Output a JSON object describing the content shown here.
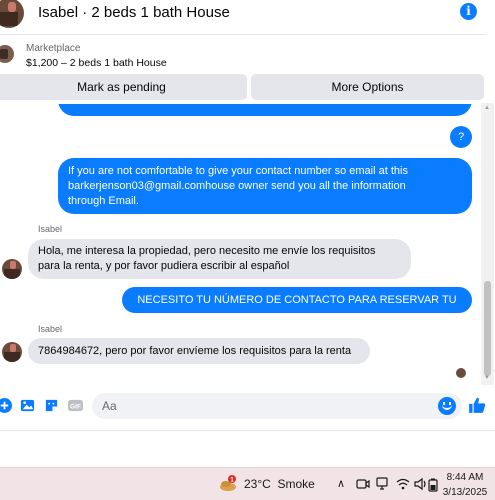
{
  "header": {
    "title": "Isabel · 2 beds 1 bath House",
    "info_icon": "info-icon",
    "info_glyph": "i"
  },
  "listing": {
    "source": "Marketplace",
    "price_title": "$1,200 – 2 beds 1 bath House"
  },
  "actions": {
    "mark_pending": "Mark as pending",
    "more_options": "More Options"
  },
  "messages": [
    {
      "from": "me",
      "text": "?"
    },
    {
      "from": "me",
      "lines": [
        "If you are not comfortable to give your contact number so email at this",
        "barkerjenson03@gmail.comhouse owner send you all the information",
        "through Email."
      ]
    },
    {
      "from": "Isabel",
      "sender_label": "Isabel",
      "lines": [
        "Hola, me interesa la propiedad, pero necesito me envíe los requisitos",
        "para la renta, y por favor pudiera escribir al español"
      ]
    },
    {
      "from": "me",
      "text": "NECESITO TU NÚMERO DE CONTACTO PARA RESERVAR TU TOUR"
    },
    {
      "from": "Isabel",
      "sender_label": "Isabel",
      "text": "7864984672, pero por favor envíeme los requisitos para la renta"
    }
  ],
  "composer": {
    "placeholder": "Aa",
    "gif_label": "GIF",
    "icons": [
      "plus-circle-icon",
      "image-icon",
      "sticker-icon",
      "gif-icon",
      "emoji-icon",
      "thumbs-up-icon"
    ]
  },
  "taskbar": {
    "temperature": "23°C",
    "weather": "Smoke",
    "alert_count": "1",
    "time": "8:44 AM",
    "date": "3/13/2025",
    "tray_icons": [
      "chevron-up-icon",
      "camera-icon",
      "network-icon",
      "wifi-icon",
      "volume-icon",
      "battery-icon"
    ]
  },
  "colors": {
    "accent": "#0a7cff",
    "bubble_in": "#e4e6eb",
    "taskbar": "#f1e3e6"
  }
}
